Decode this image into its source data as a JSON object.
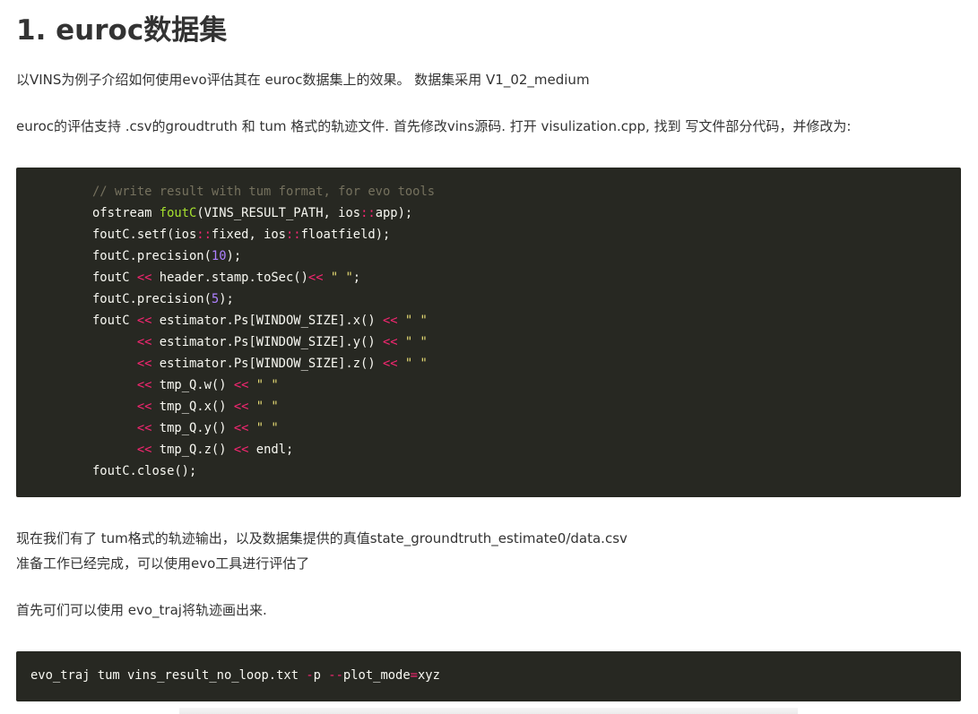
{
  "heading": "1. euroc数据集",
  "paragraphs": {
    "intro": "以VINS为例子介绍如何使用evo评估其在 euroc数据集上的效果。 数据集采用 V1_02_medium",
    "support": "euroc的评估支持 .csv的groudtruth 和 tum 格式的轨迹文件. 首先修改vins源码. 打开 visulization.cpp, 找到 写文件部分代码，并修改为:",
    "output_line1": "现在我们有了 tum格式的轨迹输出，以及数据集提供的真值state_groundtruth_estimate0/data.csv",
    "output_line2": "准备工作已经完成，可以使用evo工具进行评估了",
    "plot_intro": "首先可们可以使用 evo_traj将轨迹画出来."
  },
  "code_block_1": {
    "lines": [
      [
        {
          "t": "// write result with tum format, for evo tools",
          "c": "comment"
        }
      ],
      [
        {
          "t": "ofstream ",
          "c": "plain"
        },
        {
          "t": "foutC",
          "c": "func"
        },
        {
          "t": "(VINS_RESULT_PATH, ios",
          "c": "plain"
        },
        {
          "t": "::",
          "c": "op"
        },
        {
          "t": "app);",
          "c": "plain"
        }
      ],
      [
        {
          "t": "foutC.setf(ios",
          "c": "plain"
        },
        {
          "t": "::",
          "c": "op"
        },
        {
          "t": "fixed, ios",
          "c": "plain"
        },
        {
          "t": "::",
          "c": "op"
        },
        {
          "t": "floatfield);",
          "c": "plain"
        }
      ],
      [
        {
          "t": "foutC.precision(",
          "c": "plain"
        },
        {
          "t": "10",
          "c": "num"
        },
        {
          "t": ");",
          "c": "plain"
        }
      ],
      [
        {
          "t": "foutC ",
          "c": "plain"
        },
        {
          "t": "<<",
          "c": "op"
        },
        {
          "t": " header.stamp.toSec()",
          "c": "plain"
        },
        {
          "t": "<<",
          "c": "op"
        },
        {
          "t": " ",
          "c": "plain"
        },
        {
          "t": "\" \"",
          "c": "str"
        },
        {
          "t": ";",
          "c": "plain"
        }
      ],
      [
        {
          "t": "foutC.precision(",
          "c": "plain"
        },
        {
          "t": "5",
          "c": "num"
        },
        {
          "t": ");",
          "c": "plain"
        }
      ],
      [
        {
          "t": "foutC ",
          "c": "plain"
        },
        {
          "t": "<<",
          "c": "op"
        },
        {
          "t": " estimator.Ps[WINDOW_SIZE].x() ",
          "c": "plain"
        },
        {
          "t": "<<",
          "c": "op"
        },
        {
          "t": " ",
          "c": "plain"
        },
        {
          "t": "\" \"",
          "c": "str"
        }
      ],
      [
        {
          "t": "      ",
          "c": "plain"
        },
        {
          "t": "<<",
          "c": "op"
        },
        {
          "t": " estimator.Ps[WINDOW_SIZE].y() ",
          "c": "plain"
        },
        {
          "t": "<<",
          "c": "op"
        },
        {
          "t": " ",
          "c": "plain"
        },
        {
          "t": "\" \"",
          "c": "str"
        }
      ],
      [
        {
          "t": "      ",
          "c": "plain"
        },
        {
          "t": "<<",
          "c": "op"
        },
        {
          "t": " estimator.Ps[WINDOW_SIZE].z() ",
          "c": "plain"
        },
        {
          "t": "<<",
          "c": "op"
        },
        {
          "t": " ",
          "c": "plain"
        },
        {
          "t": "\" \"",
          "c": "str"
        }
      ],
      [
        {
          "t": "      ",
          "c": "plain"
        },
        {
          "t": "<<",
          "c": "op"
        },
        {
          "t": " tmp_Q.w() ",
          "c": "plain"
        },
        {
          "t": "<<",
          "c": "op"
        },
        {
          "t": " ",
          "c": "plain"
        },
        {
          "t": "\" \"",
          "c": "str"
        }
      ],
      [
        {
          "t": "      ",
          "c": "plain"
        },
        {
          "t": "<<",
          "c": "op"
        },
        {
          "t": " tmp_Q.x() ",
          "c": "plain"
        },
        {
          "t": "<<",
          "c": "op"
        },
        {
          "t": " ",
          "c": "plain"
        },
        {
          "t": "\" \"",
          "c": "str"
        }
      ],
      [
        {
          "t": "      ",
          "c": "plain"
        },
        {
          "t": "<<",
          "c": "op"
        },
        {
          "t": " tmp_Q.y() ",
          "c": "plain"
        },
        {
          "t": "<<",
          "c": "op"
        },
        {
          "t": " ",
          "c": "plain"
        },
        {
          "t": "\" \"",
          "c": "str"
        }
      ],
      [
        {
          "t": "      ",
          "c": "plain"
        },
        {
          "t": "<<",
          "c": "op"
        },
        {
          "t": " tmp_Q.z() ",
          "c": "plain"
        },
        {
          "t": "<<",
          "c": "op"
        },
        {
          "t": " endl;",
          "c": "plain"
        }
      ],
      [
        {
          "t": "foutC.close();",
          "c": "plain"
        }
      ]
    ]
  },
  "code_block_2": {
    "lines": [
      [
        {
          "t": "evo_traj tum vins_result_no_loop.txt ",
          "c": "plain"
        },
        {
          "t": "-",
          "c": "op"
        },
        {
          "t": "p ",
          "c": "plain"
        },
        {
          "t": "--",
          "c": "op"
        },
        {
          "t": "plot_mode",
          "c": "plain"
        },
        {
          "t": "=",
          "c": "op"
        },
        {
          "t": "xyz",
          "c": "plain"
        }
      ]
    ]
  },
  "colors": {
    "text": "#333333",
    "code_background": "#272822",
    "code_text": "#f8f8f2",
    "code_comment": "#75715e",
    "code_operator": "#f92672",
    "code_function": "#a6e22e",
    "code_number": "#ae81ff",
    "code_string": "#e6db74"
  }
}
